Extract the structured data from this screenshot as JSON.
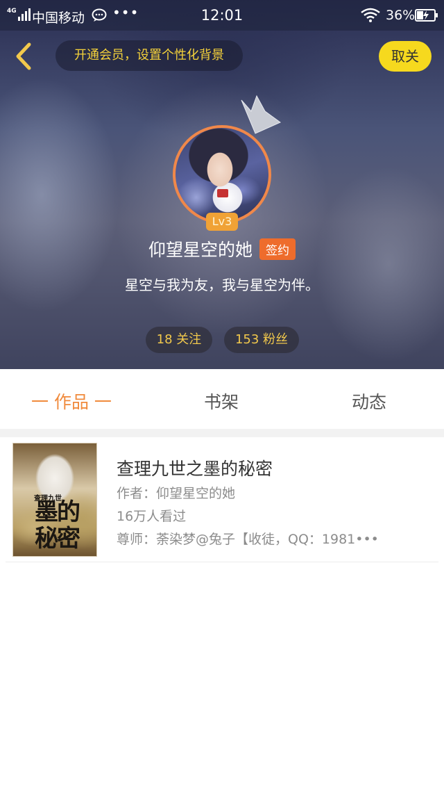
{
  "status_bar": {
    "network": "4G",
    "carrier": "中国移动",
    "more": "•••",
    "time": "12:01",
    "battery": "36%"
  },
  "top_bar": {
    "vip_banner": "开通会员，设置个性化背景",
    "unfollow_label": "取关"
  },
  "profile": {
    "level": "Lv3",
    "username": "仰望星空的她",
    "signed_badge": "签约",
    "bio": "星空与我为友，我与星空为伴。",
    "following": "18 关注",
    "fans": "153 粉丝"
  },
  "tabs": [
    {
      "label": "一 作品 一",
      "active": true
    },
    {
      "label": "书架",
      "active": false
    },
    {
      "label": "动态",
      "active": false
    }
  ],
  "books": [
    {
      "title": "查理九世之墨的秘密",
      "author": "作者：仰望星空的她",
      "views": "16万人看过",
      "intro": "尊师：荼染梦@兔子【收徒，QQ：1981•••",
      "cover_text": "墨的秘密",
      "cover_subtext": "查理九世"
    }
  ],
  "colors": {
    "accent": "#f08a3c",
    "yellow": "#f6d91e",
    "gold_text": "#f2c94c",
    "badge_orange": "#ee6c2c"
  }
}
